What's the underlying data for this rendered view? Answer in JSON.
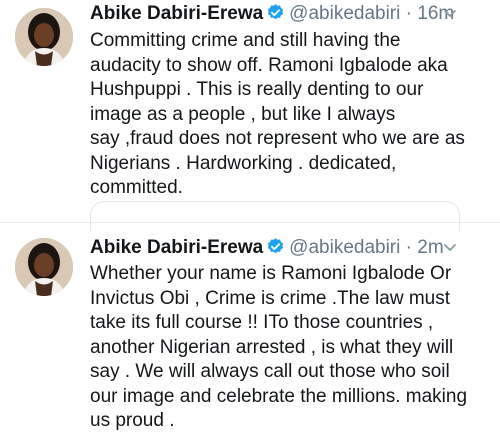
{
  "tweets": [
    {
      "author": {
        "name": "Abike Dabiri-Erewa",
        "handle": "@abikedabiri",
        "verified": true
      },
      "separator": "·",
      "time": "16m",
      "text": "Committing crime and still having the\naudacity to show off. Ramoni Igbalode aka\nHushpuppi . This is really denting to our\nimage as a people , but like I always\nsay ,fraud does not represent who we are as\nNigerians . Hardworking . dedicated,\ncommitted.",
      "menu_icon": "chevron-down-icon"
    },
    {
      "author": {
        "name": "Abike Dabiri-Erewa",
        "handle": "@abikedabiri",
        "verified": true
      },
      "separator": "·",
      "time": "2m",
      "text": "Whether your name is Ramoni Igbalode Or\nInvictus Obi , Crime is crime .The law must\ntake its full course !! ITo those countries ,\nanother Nigerian arrested , is what they will\nsay . We will always call out those who soil\nour image and celebrate the millions. making\nus proud .",
      "menu_icon": "chevron-down-icon"
    }
  ],
  "colors": {
    "text": "#14171a",
    "muted": "#657786",
    "verified": "#1da1f2",
    "border": "#e1e8ed"
  }
}
